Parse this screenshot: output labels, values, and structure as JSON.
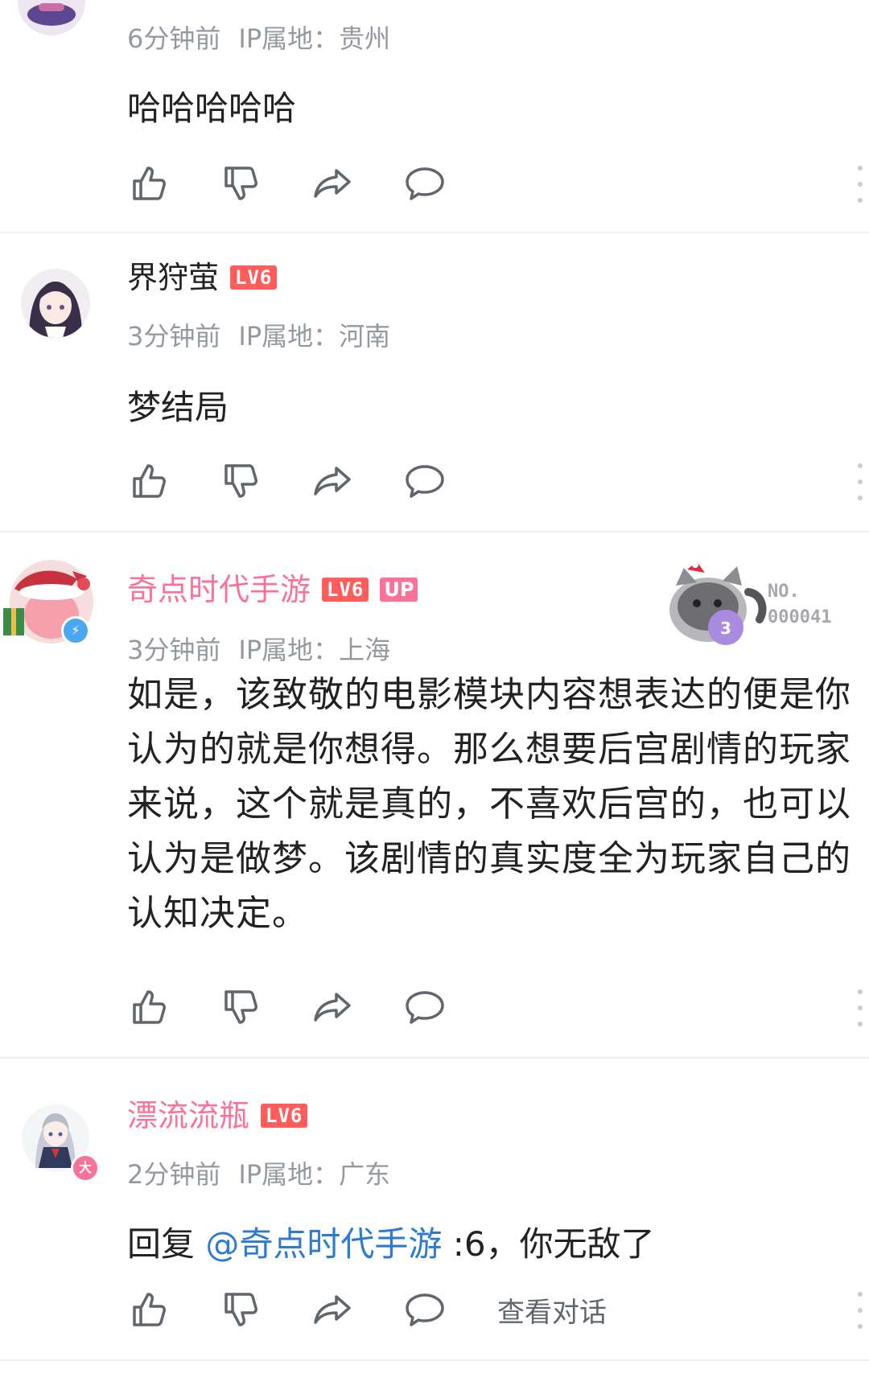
{
  "comments": [
    {
      "time": "6分钟前",
      "ip": "IP属地：贵州",
      "content": "哈哈哈哈哈"
    },
    {
      "username": "界狩萤",
      "level": "LV6",
      "time": "3分钟前",
      "ip": "IP属地：河南",
      "content": "梦结局"
    },
    {
      "username": "奇点时代手游",
      "level": "LV6",
      "up_badge": "UP",
      "time": "3分钟前",
      "ip": "IP属地：上海",
      "fan_badge_no": "NO.",
      "fan_badge_num": "000041",
      "content": "如是，该致敬的电影模块内容想表达的便是你认为的就是你想得。那么想要后宫剧情的玩家来说，这个就是真的，不喜欢后宫的，也可以认为是做梦。该剧情的真实度全为玩家自己的认知决定。"
    },
    {
      "username": "漂流流瓶",
      "level": "LV6",
      "time": "2分钟前",
      "ip": "IP属地：广东",
      "reply_prefix": "回复 ",
      "mention": "@奇点时代手游",
      "reply_text": " :6，你无敌了",
      "view_conversation": "查看对话"
    }
  ],
  "icons": [
    "thumbs-up-icon",
    "thumbs-down-icon",
    "share-icon",
    "comment-bubble-icon",
    "more-dots-icon"
  ],
  "colors": {
    "username_pink": "#fb7299",
    "level_badge": "#ff5c5c",
    "meta_gray": "#9499a0",
    "mention_blue": "#2d7bd1",
    "icon_gray": "#61666d"
  }
}
